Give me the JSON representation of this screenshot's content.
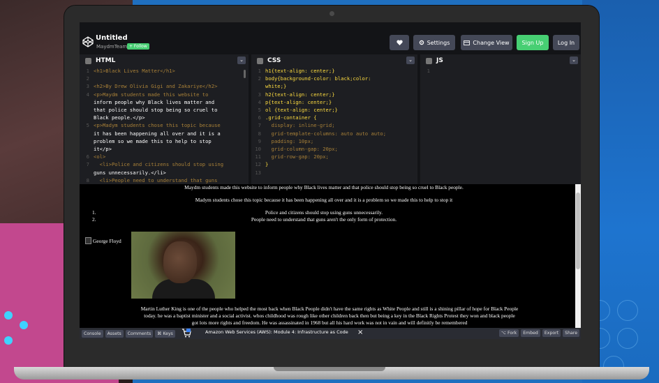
{
  "app": {
    "title": "Untitled",
    "team": "MaydmTeam",
    "follow_label": "+ Follow"
  },
  "header": {
    "settings_label": "Settings",
    "change_view_label": "Change View",
    "signup_label": "Sign Up",
    "login_label": "Log In"
  },
  "panes": {
    "html_title": "HTML",
    "css_title": "CSS",
    "js_title": "JS"
  },
  "html_code": [
    {
      "n": "1",
      "t": "<h1>Black Lives Matter</h1>"
    },
    {
      "n": "2",
      "t": ""
    },
    {
      "n": "3",
      "t": "<h2>By Drew Olivia Gigi and Zakariye</h2>"
    },
    {
      "n": "4",
      "t": "<p>Maydm students made this website to"
    },
    {
      "n": "",
      "t": "inform people why Black lives matter and"
    },
    {
      "n": "",
      "t": "that police should stop being so cruel to"
    },
    {
      "n": "",
      "t": "Black people.</p>"
    },
    {
      "n": "5",
      "t": "<p>Madym students chose this topic because"
    },
    {
      "n": "",
      "t": "it has been happening all over and it is a"
    },
    {
      "n": "",
      "t": "problem so we made this to help to stop"
    },
    {
      "n": "",
      "t": "it</p>"
    },
    {
      "n": "6",
      "t": "<ol>"
    },
    {
      "n": "7",
      "t": "  <li>Police and citizens should stop using"
    },
    {
      "n": "",
      "t": "guns unnecessarily.</li>"
    },
    {
      "n": "8",
      "t": "  <li>People need to understand that guns"
    }
  ],
  "css_code": [
    {
      "n": "1",
      "t": "h1{text-align: center;}"
    },
    {
      "n": "2",
      "t": "body{background-color: black;color:"
    },
    {
      "n": "",
      "t": "white;}"
    },
    {
      "n": "3",
      "t": "h2{text-align: center;}"
    },
    {
      "n": "4",
      "t": "p{text-align: center;}"
    },
    {
      "n": "5",
      "t": "ol {text-align: center;}"
    },
    {
      "n": "6",
      "t": ".grid-container {"
    },
    {
      "n": "7",
      "t": "  display: inline-grid;"
    },
    {
      "n": "8",
      "t": "  grid-template-columns: auto auto auto;"
    },
    {
      "n": "9",
      "t": "  padding: 10px;"
    },
    {
      "n": "10",
      "t": "  grid-column-gap: 20px;"
    },
    {
      "n": "11",
      "t": "  grid-row-gap: 20px;"
    },
    {
      "n": "12",
      "t": "}"
    },
    {
      "n": "13",
      "t": ""
    }
  ],
  "js_code": [
    {
      "n": "1",
      "t": ""
    }
  ],
  "preview": {
    "p1": "Maydm students made this website to inform people why Black lives matter and that police should stop being so cruel to Black people.",
    "p2": "Madym students chose this topic because it has been happening all over and it is a problem so we made this to help to stop it",
    "li1_num": "1.",
    "li2_num": "2.",
    "li1": "Police and citizens should stop using guns unnecessarily.",
    "li2": "People need to understand that guns aren't the only form of protection.",
    "img_alt": "George Floyd",
    "mlk_text1": "Martin Luther King is one of the people who helped the most back when Black People didn't have the same rights as White People and still is a shining pillar of hope for Black People",
    "mlk_text2": "today. he was a baptist minister and a social activist. whos childhood was rough like other children back then but being a key in the Black Rights Protest they won and black people",
    "mlk_text3": "got lots more rights and freedom. He was assassinated in 1968 but all his hard work was not in vain and will definitly be remembered"
  },
  "footer": {
    "console": "Console",
    "assets": "Assets",
    "comments": "Comments",
    "keys": "⌘ Keys",
    "ad_text": "Amazon Web Services (AWS): Module 4: Infrastructure as Code",
    "ad_close": "×",
    "fork": "⌥ Fork",
    "embed": "Embed",
    "export": "Export",
    "share": "Share"
  },
  "colors": {
    "accent_green": "#47cf73",
    "editor_bg": "#1d1e22",
    "button_bg": "#444857"
  }
}
